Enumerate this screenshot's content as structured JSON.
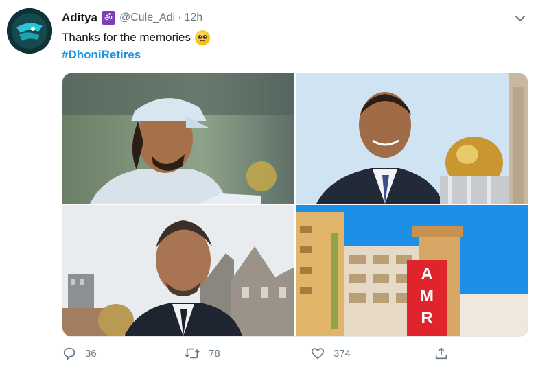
{
  "tweet": {
    "display_name": "Aditya",
    "badge_glyph": "ॐ",
    "handle": "@Cule_Adi",
    "separator": "·",
    "time": "12h",
    "text": "Thanks for the memories",
    "hashtag": "#DhoniRetires"
  },
  "media": {
    "images": [
      {
        "name": "photo-dhoni-cap"
      },
      {
        "name": "photo-dhoni-suit-trophy"
      },
      {
        "name": "photo-dhoni-buildings"
      },
      {
        "name": "photo-amr-building",
        "sign_letters": [
          "A",
          "M",
          "R"
        ]
      }
    ]
  },
  "actions": {
    "reply_count": "36",
    "retweet_count": "78",
    "like_count": "374"
  },
  "icons": {
    "reply": "reply-icon",
    "retweet": "retweet-icon",
    "like": "heart-icon",
    "share": "share-icon",
    "menu": "chevron-down-icon",
    "emoji": "pleading-face-emoji"
  },
  "colors": {
    "hashtag": "#1b95e0",
    "muted": "#657786",
    "badge": "#7b3fb8"
  }
}
